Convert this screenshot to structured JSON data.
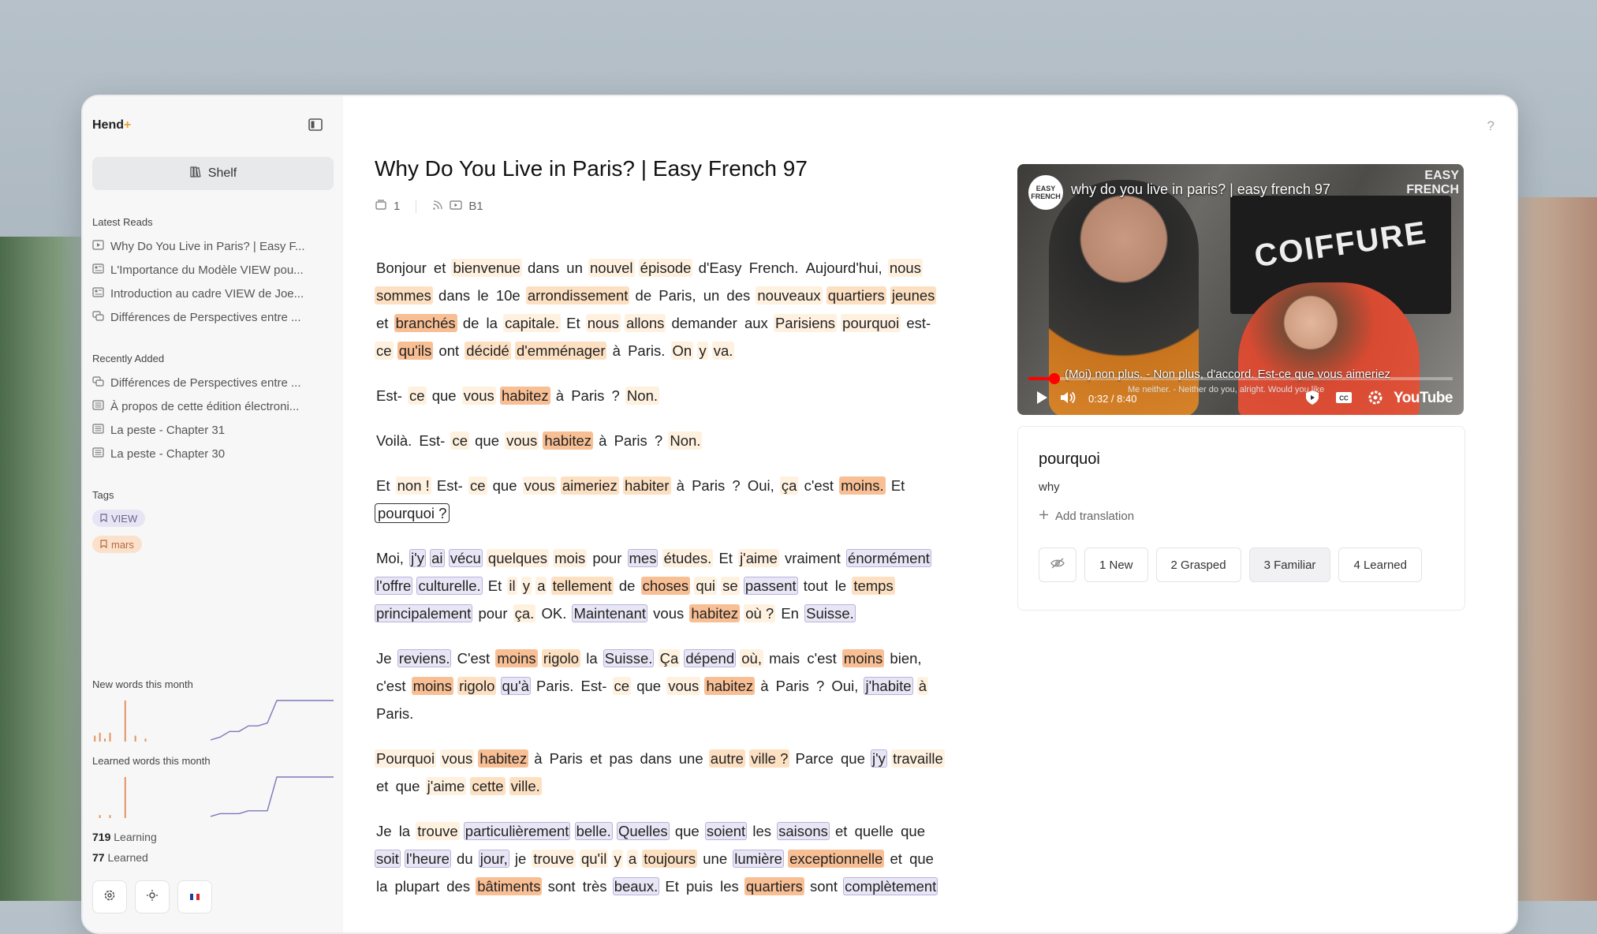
{
  "brand": {
    "name": "Hend",
    "suffix": "+"
  },
  "sidebar": {
    "shelf_label": "Shelf",
    "latest_title": "Latest Reads",
    "latest": [
      "Why Do You Live in Paris? | Easy F...",
      "L'Importance du Modèle VIEW pou...",
      "Introduction au cadre VIEW de Joe...",
      "Différences de Perspectives entre ..."
    ],
    "recent_title": "Recently Added",
    "recent": [
      "Différences de Perspectives entre ...",
      "À propos de cette édition électroni...",
      "La peste - Chapter 31",
      "La peste - Chapter 30"
    ],
    "tags_title": "Tags",
    "tags": [
      "VIEW",
      "mars"
    ],
    "new_words_title": "New words this month",
    "learned_words_title": "Learned words this month",
    "learning_count": "719",
    "learning_label": "Learning",
    "learned_count": "77",
    "learned_label": "Learned"
  },
  "article": {
    "title": "Why Do You Live in Paris? | Easy French 97",
    "pages": "1",
    "level": "B1"
  },
  "video": {
    "title": "why do you live in paris? | easy french 97",
    "channel": "EASY FRENCH",
    "watermark_line1": "EASY",
    "watermark_line2": "FRENCH",
    "shop_sign": "COIFFURE",
    "caption": "(Moi) non plus. - Non plus, d'accord. Est-ce que vous aimeriez",
    "caption_sub": "Me neither. - Neither do you, alright. Would you like",
    "time": "0:32 / 8:40",
    "progress_fraction": 0.062,
    "brand": "YouTube"
  },
  "panel": {
    "word": "pourquoi",
    "translation": "why",
    "add_translation": "Add translation",
    "levels": [
      "1  New",
      "2  Grasped",
      "3  Familiar",
      "4  Learned"
    ],
    "active_level": 2
  },
  "chart_data": [
    {
      "type": "bar",
      "title": "New words this month",
      "values": [
        2,
        3,
        1,
        3,
        0,
        0,
        14,
        0,
        2,
        0,
        1,
        0,
        0,
        0
      ]
    },
    {
      "type": "line",
      "title": "New words this month",
      "values": [
        0,
        1,
        3,
        3,
        5,
        5,
        6,
        14,
        14,
        14,
        14,
        14,
        14,
        14
      ]
    },
    {
      "type": "bar",
      "title": "Learned words this month",
      "values": [
        0,
        1,
        0,
        1,
        0,
        0,
        14,
        0,
        0,
        0,
        0,
        0,
        0,
        0
      ]
    },
    {
      "type": "line",
      "title": "Learned words this month",
      "values": [
        0,
        1,
        1,
        1,
        2,
        2,
        2,
        14,
        14,
        14,
        14,
        14,
        14,
        14
      ]
    }
  ],
  "paragraphs": [
    [
      [
        "Bonjour",
        ""
      ],
      [
        "et",
        ""
      ],
      [
        "bienvenue",
        "n"
      ],
      [
        "dans",
        ""
      ],
      [
        "un",
        ""
      ],
      [
        "nouvel",
        "n"
      ],
      [
        "épisode",
        "n"
      ],
      [
        "d'Easy",
        ""
      ],
      [
        "French.",
        ""
      ],
      [
        "Aujourd'hui,",
        ""
      ],
      [
        "nous",
        "n"
      ],
      [
        "sommes",
        "a"
      ],
      [
        "dans",
        ""
      ],
      [
        "le",
        ""
      ],
      [
        "10e",
        ""
      ],
      [
        "arrondissement",
        "a"
      ],
      [
        "de",
        ""
      ],
      [
        "Paris,",
        ""
      ],
      [
        "un",
        ""
      ],
      [
        "des",
        ""
      ],
      [
        "nouveaux",
        "n"
      ],
      [
        "quartiers",
        "a"
      ],
      [
        "jeunes",
        "a"
      ],
      [
        "et",
        ""
      ],
      [
        "branchés",
        "f"
      ],
      [
        "de",
        ""
      ],
      [
        "la",
        ""
      ],
      [
        "capitale.",
        "n"
      ],
      [
        "Et",
        ""
      ],
      [
        "nous",
        "n"
      ],
      [
        "allons",
        "n"
      ],
      [
        "demander",
        ""
      ],
      [
        "aux",
        ""
      ],
      [
        "Parisiens",
        "n"
      ],
      [
        "pourquoi",
        "n"
      ],
      [
        "est-",
        ""
      ],
      [
        "ce",
        "n"
      ],
      [
        "qu'ils",
        "f"
      ],
      [
        "ont",
        ""
      ],
      [
        "décidé",
        "a"
      ],
      [
        "d'emménager",
        "a"
      ],
      [
        "à",
        ""
      ],
      [
        "Paris.",
        ""
      ],
      [
        "On",
        "n"
      ],
      [
        "y",
        "n"
      ],
      [
        "va.",
        "n"
      ]
    ],
    [
      [
        "Est-",
        ""
      ],
      [
        "ce",
        "n"
      ],
      [
        "que",
        ""
      ],
      [
        "vous",
        "n"
      ],
      [
        "habitez",
        "f"
      ],
      [
        "à",
        ""
      ],
      [
        "Paris",
        ""
      ],
      [
        "?",
        ""
      ],
      [
        "Non.",
        "n"
      ]
    ],
    [
      [
        "Voilà.",
        ""
      ],
      [
        "Est-",
        ""
      ],
      [
        "ce",
        "n"
      ],
      [
        "que",
        ""
      ],
      [
        "vous",
        "n"
      ],
      [
        "habitez",
        "f"
      ],
      [
        "à",
        ""
      ],
      [
        "Paris",
        ""
      ],
      [
        "?",
        ""
      ],
      [
        "Non.",
        "n"
      ]
    ],
    [
      [
        "Et",
        ""
      ],
      [
        "non !",
        "n"
      ],
      [
        "Est-",
        ""
      ],
      [
        "ce",
        "n"
      ],
      [
        "que",
        ""
      ],
      [
        "vous",
        "n"
      ],
      [
        "aimeriez",
        "a"
      ],
      [
        "habiter",
        "a"
      ],
      [
        "à",
        ""
      ],
      [
        "Paris",
        ""
      ],
      [
        "?",
        ""
      ],
      [
        "Oui,",
        ""
      ],
      [
        "ça",
        "n"
      ],
      [
        "c'est",
        ""
      ],
      [
        "moins.",
        "f"
      ],
      [
        "Et",
        ""
      ],
      [
        "pourquoi ?",
        "sel"
      ]
    ],
    [
      [
        "Moi,",
        ""
      ],
      [
        "j'y",
        "l"
      ],
      [
        "ai",
        "l"
      ],
      [
        "vécu",
        "l"
      ],
      [
        "quelques",
        "n"
      ],
      [
        "mois",
        "n"
      ],
      [
        "pour",
        ""
      ],
      [
        "mes",
        "l"
      ],
      [
        "études.",
        "n"
      ],
      [
        "Et",
        ""
      ],
      [
        "j'aime",
        "n"
      ],
      [
        "vraiment",
        ""
      ],
      [
        "énormément",
        "l"
      ],
      [
        "l'offre",
        "l"
      ],
      [
        "culturelle.",
        "l"
      ],
      [
        "Et",
        ""
      ],
      [
        "il",
        "n"
      ],
      [
        "y",
        "n"
      ],
      [
        "a",
        "n"
      ],
      [
        "tellement",
        "a"
      ],
      [
        "de",
        ""
      ],
      [
        "choses",
        "f"
      ],
      [
        "qui",
        "n"
      ],
      [
        "se",
        "n"
      ],
      [
        "passent",
        "l"
      ],
      [
        "tout",
        ""
      ],
      [
        "le",
        ""
      ],
      [
        "temps",
        "a"
      ],
      [
        "principalement",
        "l"
      ],
      [
        "pour",
        ""
      ],
      [
        "ça.",
        "n"
      ],
      [
        "OK.",
        ""
      ],
      [
        "Maintenant",
        "l"
      ],
      [
        "vous",
        ""
      ],
      [
        "habitez",
        "f"
      ],
      [
        "où ?",
        "n"
      ],
      [
        "En",
        ""
      ],
      [
        "Suisse.",
        "l"
      ]
    ],
    [
      [
        "Je",
        ""
      ],
      [
        "reviens.",
        "l"
      ],
      [
        "C'est",
        ""
      ],
      [
        "moins",
        "f"
      ],
      [
        "rigolo",
        "a"
      ],
      [
        "la",
        ""
      ],
      [
        "Suisse.",
        "l"
      ],
      [
        "Ça",
        "n"
      ],
      [
        "dépend",
        "l"
      ],
      [
        "où,",
        "n"
      ],
      [
        "mais",
        ""
      ],
      [
        "c'est",
        ""
      ],
      [
        "moins",
        "f"
      ],
      [
        "bien,",
        ""
      ],
      [
        "c'est",
        ""
      ],
      [
        "moins",
        "f"
      ],
      [
        "rigolo",
        "a"
      ],
      [
        "qu'à",
        "l"
      ],
      [
        "Paris.",
        ""
      ],
      [
        "Est-",
        ""
      ],
      [
        "ce",
        "n"
      ],
      [
        "que",
        ""
      ],
      [
        "vous",
        "n"
      ],
      [
        "habitez",
        "f"
      ],
      [
        "à",
        ""
      ],
      [
        "Paris",
        ""
      ],
      [
        "?",
        ""
      ],
      [
        "Oui,",
        ""
      ],
      [
        "j'habite",
        "l"
      ],
      [
        "à",
        "n"
      ],
      [
        "Paris.",
        ""
      ]
    ],
    [
      [
        "Pourquoi",
        "n"
      ],
      [
        "vous",
        "n"
      ],
      [
        "habitez",
        "f"
      ],
      [
        "à",
        ""
      ],
      [
        "Paris",
        ""
      ],
      [
        "et",
        ""
      ],
      [
        "pas",
        ""
      ],
      [
        "dans",
        ""
      ],
      [
        "une",
        ""
      ],
      [
        "autre",
        "a"
      ],
      [
        "ville ?",
        "a"
      ],
      [
        "Parce",
        ""
      ],
      [
        "que",
        ""
      ],
      [
        "j'y",
        "l"
      ],
      [
        "travaille",
        "n"
      ],
      [
        "et",
        ""
      ],
      [
        "que",
        ""
      ],
      [
        "j'aime",
        "n"
      ],
      [
        "cette",
        "a"
      ],
      [
        "ville.",
        "a"
      ]
    ],
    [
      [
        "Je",
        ""
      ],
      [
        "la",
        ""
      ],
      [
        "trouve",
        "n"
      ],
      [
        "particulièrement",
        "l"
      ],
      [
        "belle.",
        "l"
      ],
      [
        "Quelles",
        "l"
      ],
      [
        "que",
        ""
      ],
      [
        "soient",
        "l"
      ],
      [
        "les",
        ""
      ],
      [
        "saisons",
        "l"
      ],
      [
        "et",
        ""
      ],
      [
        "quelle",
        ""
      ],
      [
        "que",
        ""
      ],
      [
        "soit",
        "l"
      ],
      [
        "l'heure",
        "l"
      ],
      [
        "du",
        ""
      ],
      [
        "jour,",
        "l"
      ],
      [
        "je",
        ""
      ],
      [
        "trouve",
        "n"
      ],
      [
        "qu'il",
        "n"
      ],
      [
        "y",
        "n"
      ],
      [
        "a",
        "n"
      ],
      [
        "toujours",
        "a"
      ],
      [
        "une",
        ""
      ],
      [
        "lumière",
        "l"
      ],
      [
        "exceptionnelle",
        "f"
      ],
      [
        "et",
        ""
      ],
      [
        "que",
        ""
      ],
      [
        "la",
        ""
      ],
      [
        "plupart",
        ""
      ],
      [
        "des",
        ""
      ],
      [
        "bâtiments",
        "f"
      ],
      [
        "sont",
        ""
      ],
      [
        "très",
        ""
      ],
      [
        "beaux.",
        "l"
      ],
      [
        "Et",
        ""
      ],
      [
        "puis",
        ""
      ],
      [
        "les",
        ""
      ],
      [
        "quartiers",
        "f"
      ],
      [
        "sont",
        ""
      ],
      [
        "complètement",
        "l"
      ]
    ]
  ]
}
